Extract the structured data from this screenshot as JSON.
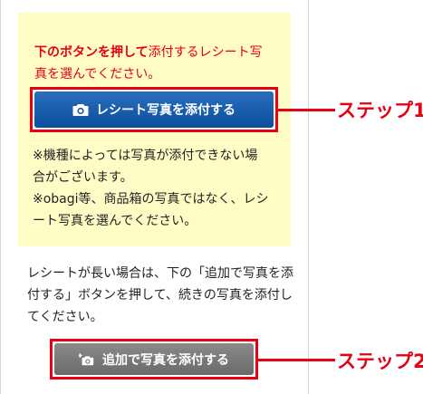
{
  "instruction": {
    "bold_text": "下のボタンを押して",
    "rest_line1": "添付するレシート写",
    "rest_line2": "真を選んでください。"
  },
  "buttons": {
    "attach_receipt": "レシート写真を添付する",
    "add_attach": "追加で写真を添付する"
  },
  "note": {
    "line1": "※機種によっては写真が添付できない場",
    "line2": "合がございます。",
    "line3": "※obagi等、商品箱の写真ではなく、レシ",
    "line4": "ート写真を選んでください。"
  },
  "guide": {
    "line1": "レシートが長い場合は、下の「追加で写真を添",
    "line2": "付する」ボタンを押して、続きの写真を添付し",
    "line3": "てください。"
  },
  "steps": {
    "step1": "ステップ1",
    "step2": "ステップ2"
  },
  "colors": {
    "accent_red": "#e60012",
    "button_blue": "#0b4f9c",
    "button_gray": "#707070",
    "note_background": "#fffcc6"
  },
  "icons": {
    "attach_button_icon": "camera-icon",
    "add_button_icon": "camera-plus-icon"
  }
}
